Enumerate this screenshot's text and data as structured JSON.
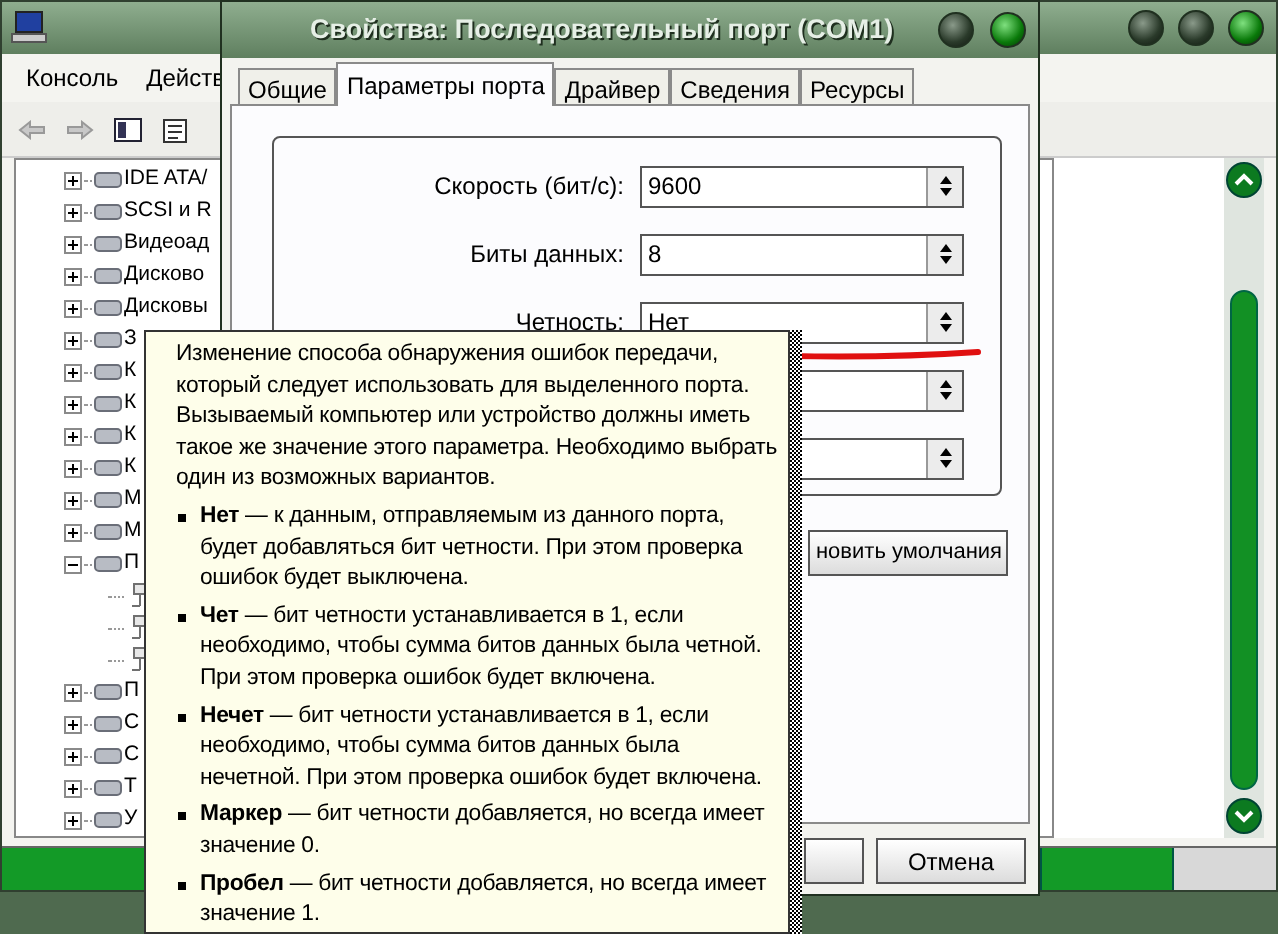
{
  "main_window": {
    "menu": [
      {
        "label": "Консоль"
      },
      {
        "label": "Действ"
      }
    ],
    "tree": [
      {
        "label": "IDE ATA/",
        "expanded": false
      },
      {
        "label": "SCSI и R",
        "expanded": false
      },
      {
        "label": "Видеоад",
        "expanded": false
      },
      {
        "label": "Дисково",
        "expanded": false
      },
      {
        "label": "Дисковы",
        "expanded": false
      },
      {
        "label": "З",
        "expanded": false
      },
      {
        "label": "К",
        "expanded": false
      },
      {
        "label": "К",
        "expanded": false
      },
      {
        "label": "К",
        "expanded": false
      },
      {
        "label": "К",
        "expanded": false
      },
      {
        "label": "М",
        "expanded": false
      },
      {
        "label": "М",
        "expanded": false
      },
      {
        "label": "П",
        "expanded": true,
        "children": [
          {
            "kind": "port"
          },
          {
            "kind": "port"
          },
          {
            "kind": "port"
          }
        ]
      },
      {
        "label": "П",
        "expanded": false
      },
      {
        "label": "С",
        "expanded": false
      },
      {
        "label": "С",
        "expanded": false
      },
      {
        "label": "Т",
        "expanded": false
      },
      {
        "label": "У",
        "expanded": false
      }
    ]
  },
  "dialog": {
    "title": "Свойства: Последовательный порт (COM1)",
    "tabs": [
      {
        "label": "Общие",
        "selected": false
      },
      {
        "label": "Параметры порта",
        "selected": true
      },
      {
        "label": "Драйвер",
        "selected": false
      },
      {
        "label": "Сведения",
        "selected": false
      },
      {
        "label": "Ресурсы",
        "selected": false
      }
    ],
    "fields": [
      {
        "kind": "combo",
        "label": "Скорость (бит/с):",
        "value": "9600"
      },
      {
        "kind": "combo",
        "label": "Биты данных:",
        "value": "8"
      },
      {
        "kind": "combo",
        "label": "Четность:",
        "value": "Нет"
      },
      {
        "kind": "combo"
      },
      {
        "kind": "combo"
      }
    ],
    "restore_button": "новить умолчания",
    "cancel_button": "Отмена"
  },
  "tooltip": {
    "intro": "Изменение способа обнаружения ошибок передачи, который следует использовать для выделенного порта. Вызываемый компьютер или устройство должны иметь такое же значение этого параметра. Необходимо выбрать один из возможных вариантов.",
    "options": [
      "**Нет** — к данным, отправляемым из данного порта, будет добавляться бит четности. При этом проверка ошибок будет выключена.",
      "**Чет** — бит четности устанавливается в 1, если необходимо, чтобы сумма битов данных была четной. При этом проверка ошибок будет включена.",
      "**Нечет** — бит четности устанавливается в 1, если необходимо, чтобы сумма битов данных была нечетной. При этом проверка ошибок будет включена.",
      "**Маркер** — бит четности добавляется, но всегда имеет значение 0.",
      "**Пробел** — бит четности добавляется, но всегда имеет значение 1."
    ]
  }
}
